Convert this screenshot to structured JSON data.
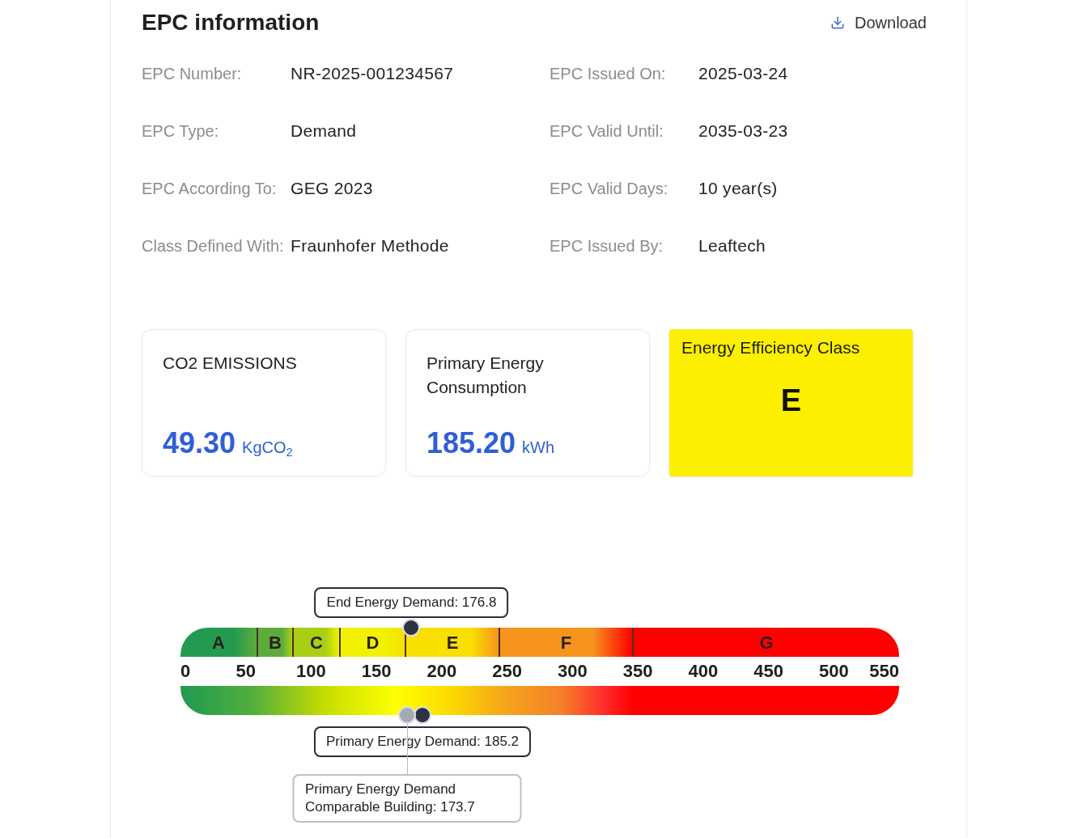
{
  "header": {
    "title": "EPC information",
    "download": {
      "label": "Download"
    }
  },
  "fields": [
    {
      "label": "EPC Number:",
      "value": "NR-2025-001234567"
    },
    {
      "label": "EPC Issued On:",
      "value": "2025-03-24"
    },
    {
      "label": "EPC Type:",
      "value": "Demand"
    },
    {
      "label": "EPC Valid Until:",
      "value": "2035-03-23"
    },
    {
      "label": "EPC According To:",
      "value": "GEG 2023"
    },
    {
      "label": "EPC Valid Days:",
      "value": "10 year(s)"
    },
    {
      "label": "Class Defined With:",
      "value": "Fraunhofer Methode"
    },
    {
      "label": "EPC Issued By:",
      "value": "Leaftech"
    }
  ],
  "cards": [
    {
      "kind": "metric",
      "title": "CO2 EMISSIONS",
      "value": "49.30",
      "unit": "KgCO$_{2}$"
    },
    {
      "kind": "metric",
      "title": "Primary Energy Consumption",
      "value": "185.20",
      "unit": "kWh"
    },
    {
      "kind": "class",
      "title": "Energy Efficiency Class",
      "value": "E"
    }
  ],
  "scale": {
    "bands": [
      {
        "label": "A",
        "color": "#239a50"
      },
      {
        "label": "B",
        "color": "#5dac3b"
      },
      {
        "label": "C",
        "color": "#a9cf14"
      },
      {
        "label": "D",
        "color": "#f1f100"
      },
      {
        "label": "E",
        "color": "#f8e000"
      },
      {
        "label": "F",
        "color": "#f7941d"
      },
      {
        "label": "G",
        "color": "#ff0000"
      }
    ],
    "ticks": [
      "0",
      "50",
      "100",
      "150",
      "200",
      "250",
      "300",
      "350",
      "400",
      "450",
      "500",
      "550"
    ],
    "markers": [
      {
        "kind": "end_demand",
        "label": "End Energy Demand: 176.8",
        "level": 0.3215
      },
      {
        "kind": "primary_demand",
        "label": "Primary Energy Demand: 185.2",
        "level": 0.3367
      },
      {
        "kind": "comparison",
        "label": "Primary Energy Demand Comparable Building: 173.7",
        "level": 0.3158
      }
    ]
  }
}
